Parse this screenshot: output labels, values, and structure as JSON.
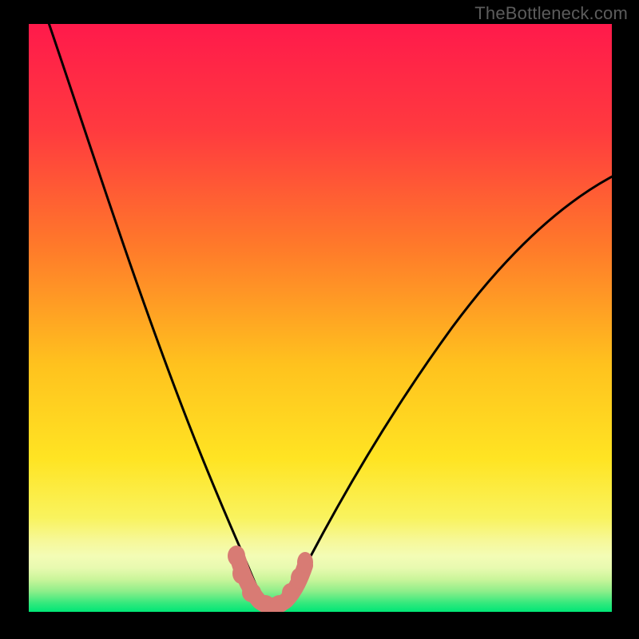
{
  "watermark": "TheBottleneck.com",
  "chart_data": {
    "type": "line",
    "title": "",
    "xlabel": "",
    "ylabel": "",
    "xlim": [
      0,
      100
    ],
    "ylim": [
      0,
      100
    ],
    "series": [
      {
        "name": "left-curve",
        "x": [
          3,
          8,
          14,
          20,
          26,
          30,
          33,
          35,
          37,
          38.5,
          40
        ],
        "y": [
          100,
          84,
          68,
          52,
          36,
          24,
          14,
          8,
          4,
          1.5,
          0.5
        ]
      },
      {
        "name": "right-curve",
        "x": [
          43,
          45,
          48,
          52,
          58,
          66,
          76,
          88,
          100
        ],
        "y": [
          0.5,
          2,
          6,
          13,
          24,
          38,
          52,
          64,
          74
        ]
      },
      {
        "name": "bottleneck-markers",
        "x": [
          35.5,
          36.5,
          38,
          40,
          42,
          44,
          45.5,
          46.5
        ],
        "y": [
          8.5,
          5.5,
          2.5,
          1,
          1,
          2.5,
          5,
          8
        ]
      }
    ],
    "gradient_colors": {
      "top": "#ff1a4b",
      "upper_mid": "#ff6a2a",
      "mid": "#ffd21a",
      "lower_mid": "#f8f86a",
      "band": "#f3fca8",
      "bottom": "#00e977"
    },
    "marker_color": "#d87b74",
    "curve_color": "#000000"
  }
}
